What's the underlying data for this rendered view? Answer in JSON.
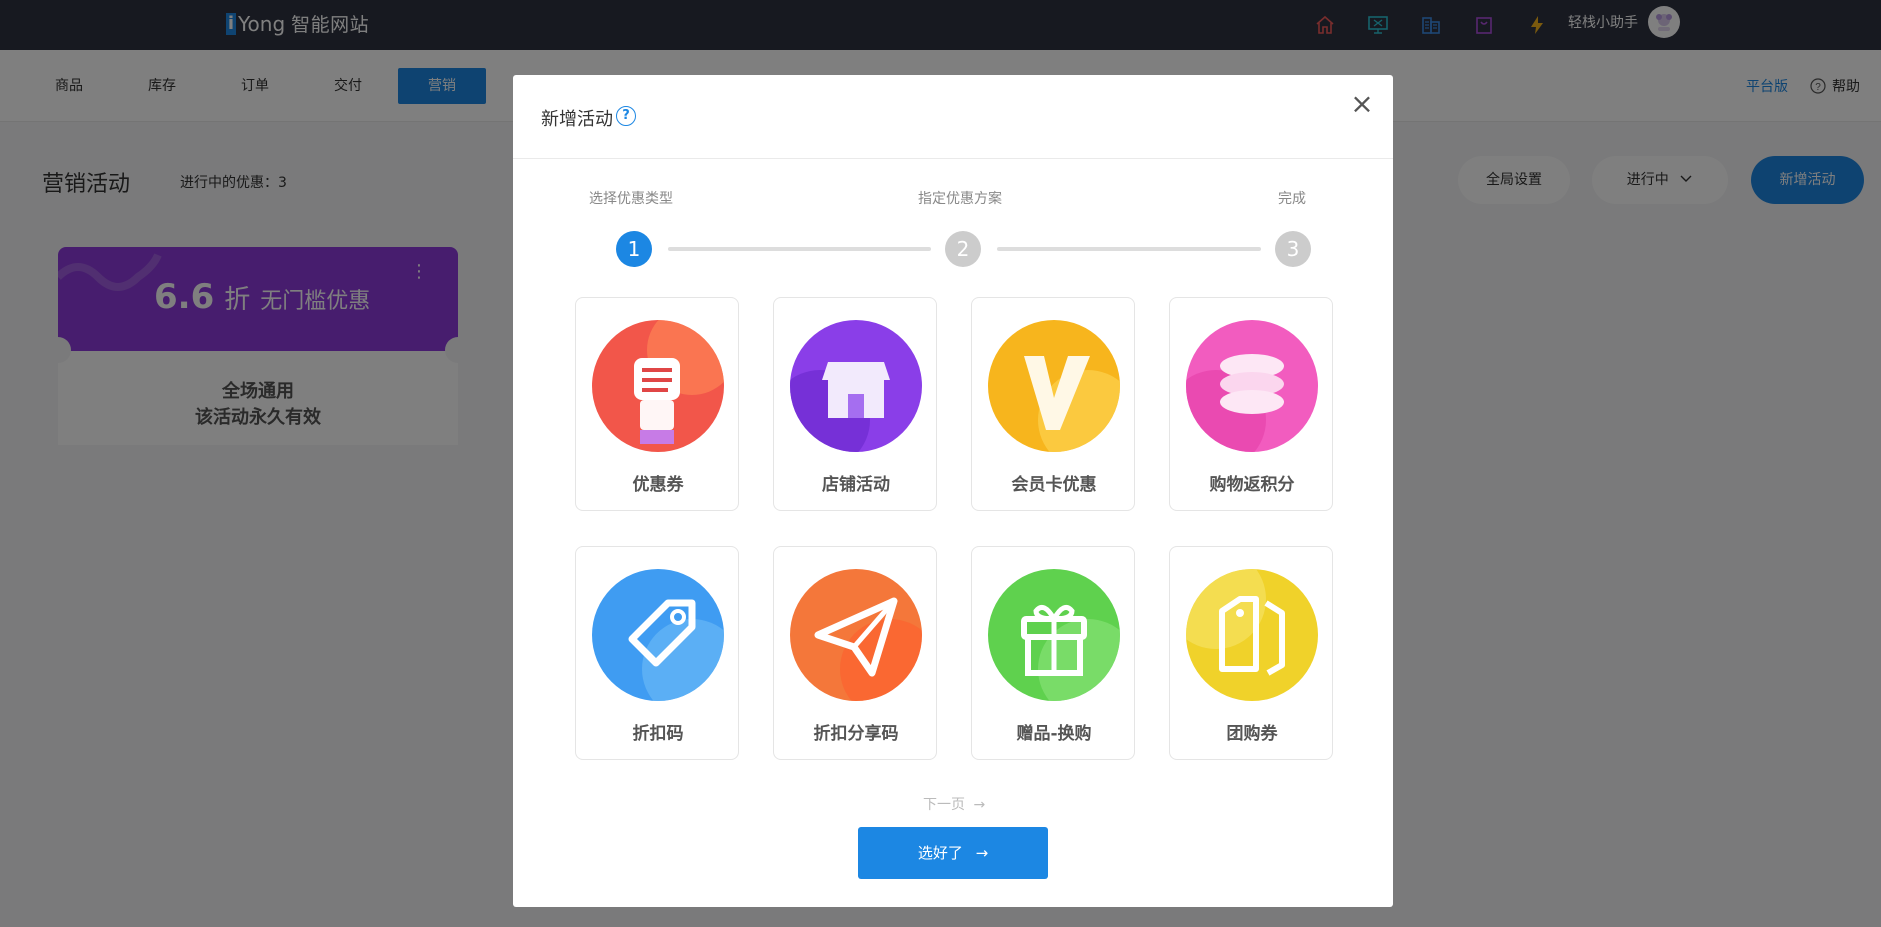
{
  "topbar": {
    "logo_i": "i",
    "logo_yong": "Yong",
    "logo_name": "智能网站",
    "icons": [
      "home-icon",
      "monitor-icon",
      "building-icon",
      "bag-icon",
      "lightning-icon"
    ],
    "assistant": "轻栈小助手"
  },
  "nav": {
    "tabs": [
      "商品",
      "库存",
      "订单",
      "交付",
      "营销"
    ],
    "active": "营销",
    "platform": "平台版",
    "help": "帮助"
  },
  "page": {
    "title": "营销活动",
    "active_count": "进行中的优惠：3",
    "global_settings": "全局设置",
    "status_filter": "进行中",
    "new_activity": "新增活动"
  },
  "coupon": {
    "value": "6.6",
    "unit": "折",
    "desc": "无门槛优惠",
    "menu": "⋮",
    "scope": "全场通用",
    "validity": "该活动永久有效",
    "color": "#8e3bdc"
  },
  "modal": {
    "title": "新增活动",
    "help": "?",
    "close": "×",
    "steps": [
      {
        "label": "选择优惠类型",
        "num": "1"
      },
      {
        "label": "指定优惠方案",
        "num": "2"
      },
      {
        "label": "完成",
        "num": "3"
      }
    ],
    "types": [
      {
        "label": "优惠券",
        "icon": "coupon-hand-icon",
        "color": "#f2564a"
      },
      {
        "label": "店铺活动",
        "icon": "store-icon",
        "color": "#8a3ee8"
      },
      {
        "label": "会员卡优惠",
        "icon": "vip-v-icon",
        "color": "#f7b51d"
      },
      {
        "label": "购物返积分",
        "icon": "coins-icon",
        "color": "#f25cbf"
      },
      {
        "label": "折扣码",
        "icon": "tag-icon",
        "color": "#3f9cf2"
      },
      {
        "label": "折扣分享码",
        "icon": "paper-plane-icon",
        "color": "#f4773a"
      },
      {
        "label": "赠品-换购",
        "icon": "gift-icon",
        "color": "#5fd14e"
      },
      {
        "label": "团购券",
        "icon": "tags-icon",
        "color": "#f0d22a"
      }
    ],
    "next_page": "下一页",
    "confirm": "选好了"
  }
}
